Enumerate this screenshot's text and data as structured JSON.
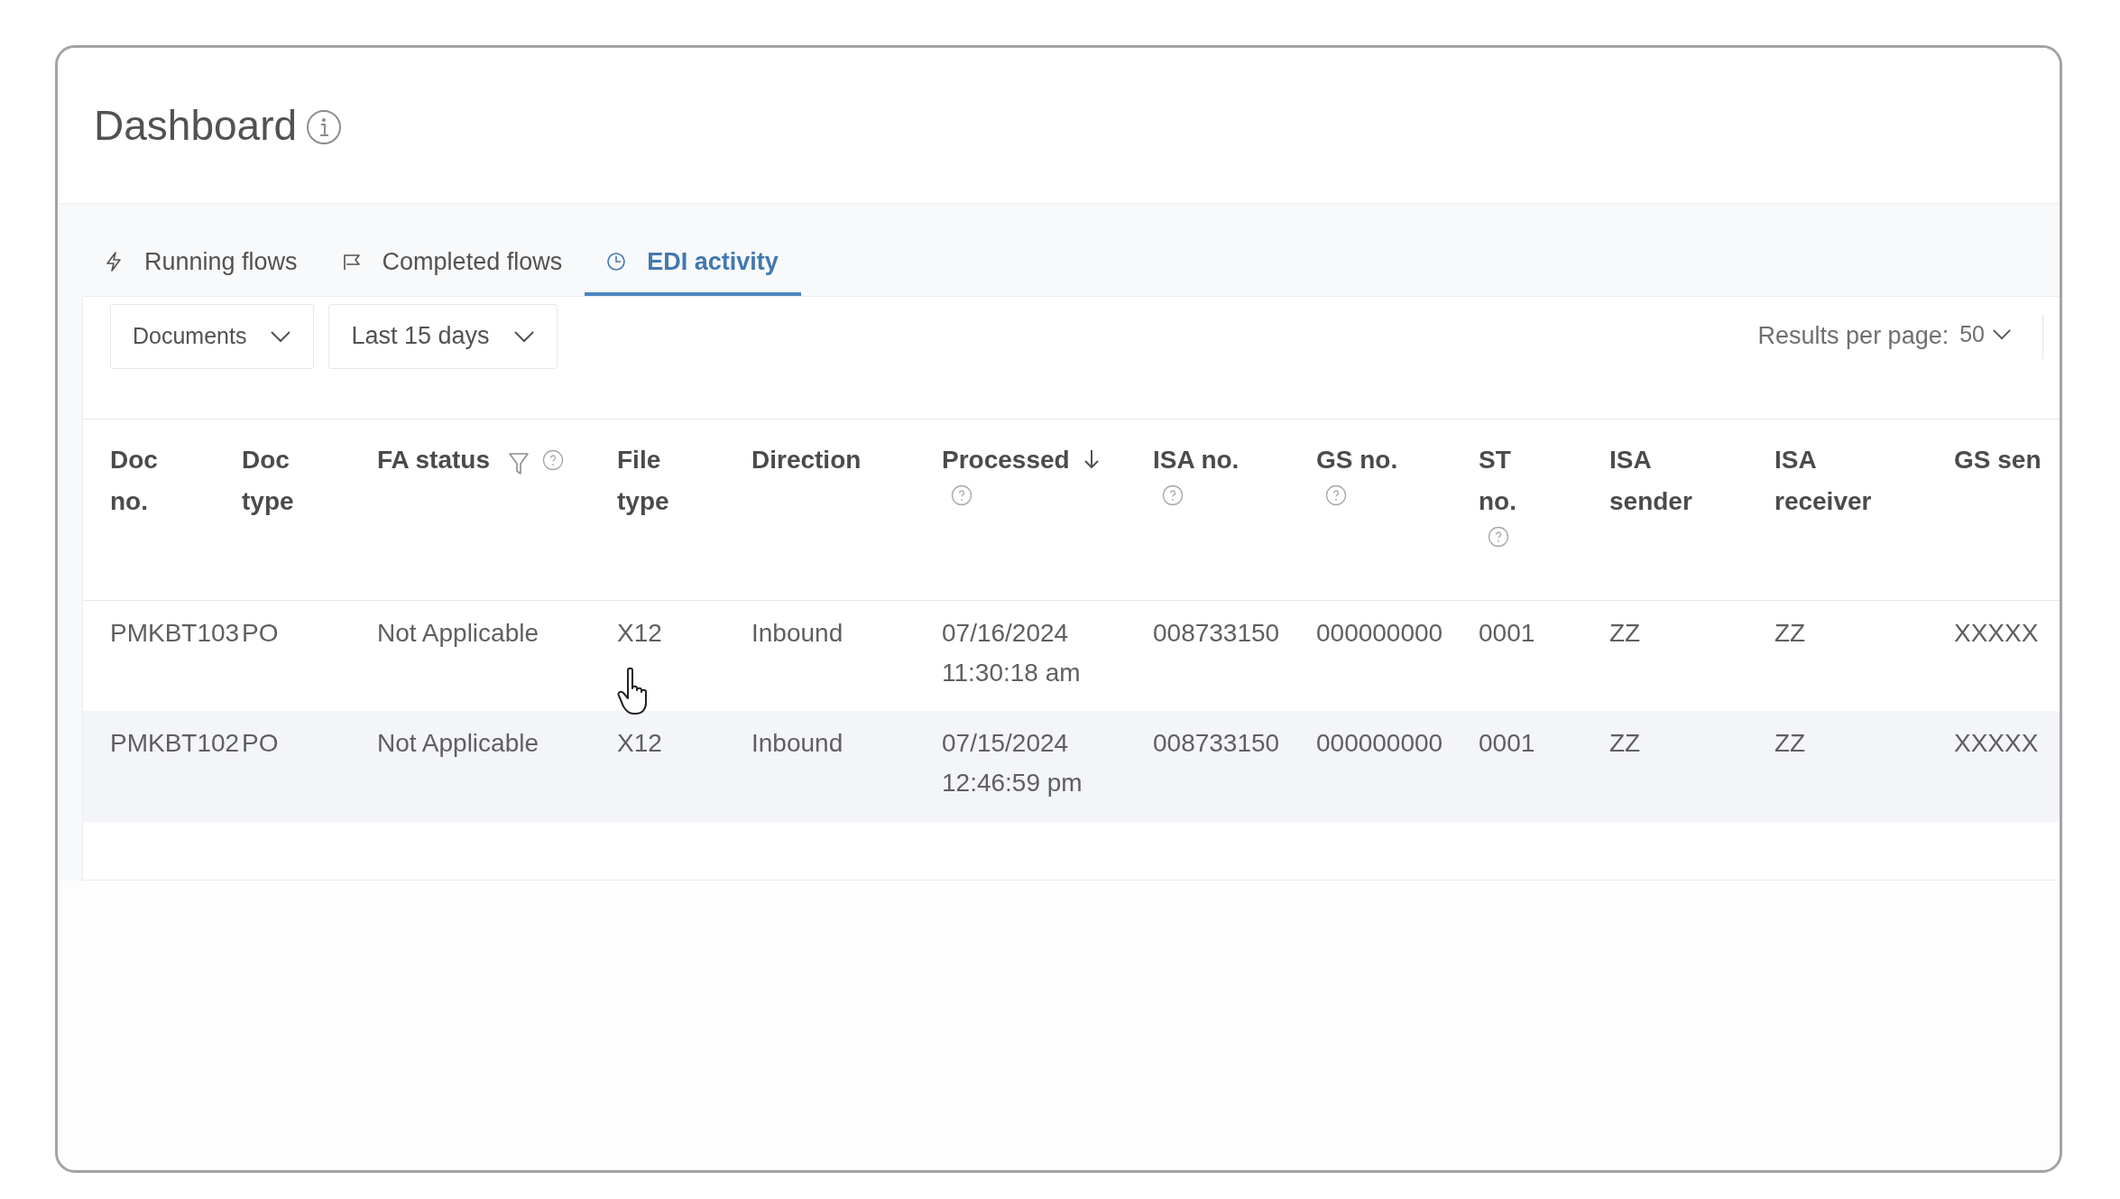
{
  "page": {
    "title": "Dashboard"
  },
  "tabs": [
    {
      "label": "Running flows",
      "selected": false
    },
    {
      "label": "Completed flows",
      "selected": false
    },
    {
      "label": "EDI activity",
      "selected": true
    }
  ],
  "filters": [
    {
      "value": "Documents"
    },
    {
      "value": "Last 15 days"
    }
  ],
  "pagination": {
    "label": "Results per page:",
    "value": "50"
  },
  "table": {
    "columns": [
      {
        "label": "Doc no.",
        "filterable": false,
        "help": false,
        "sorted": false
      },
      {
        "label": "Doc type",
        "filterable": false,
        "help": false,
        "sorted": false
      },
      {
        "label": "FA status",
        "filterable": true,
        "help": true,
        "sorted": false
      },
      {
        "label": "File type",
        "filterable": false,
        "help": false,
        "sorted": false
      },
      {
        "label": "Direction",
        "filterable": false,
        "help": false,
        "sorted": false
      },
      {
        "label": "Processed",
        "filterable": false,
        "help": true,
        "sorted": true
      },
      {
        "label": "ISA no.",
        "filterable": false,
        "help": true,
        "sorted": false
      },
      {
        "label": "GS no.",
        "filterable": false,
        "help": true,
        "sorted": false
      },
      {
        "label": "ST no.",
        "filterable": false,
        "help": true,
        "sorted": false
      },
      {
        "label": "ISA sender",
        "filterable": false,
        "help": false,
        "sorted": false
      },
      {
        "label": "ISA receiver",
        "filterable": false,
        "help": false,
        "sorted": false
      },
      {
        "label": "GS sen",
        "filterable": false,
        "help": false,
        "sorted": false
      }
    ],
    "rows": [
      {
        "hovered": false,
        "cells": [
          "PMKBT103",
          "PO",
          "Not Applicable",
          "X12",
          "Inbound",
          "07/16/2024 11:30:18 am",
          "008733150",
          "000000000",
          "0001",
          "ZZ",
          "ZZ",
          "XXXXX"
        ]
      },
      {
        "hovered": true,
        "cells": [
          "PMKBT102",
          "PO",
          "Not Applicable",
          "X12",
          "Inbound",
          "07/15/2024 12:46:59 pm",
          "008733150",
          "000000000",
          "0001",
          "ZZ",
          "ZZ",
          "XXXXX"
        ]
      }
    ]
  }
}
